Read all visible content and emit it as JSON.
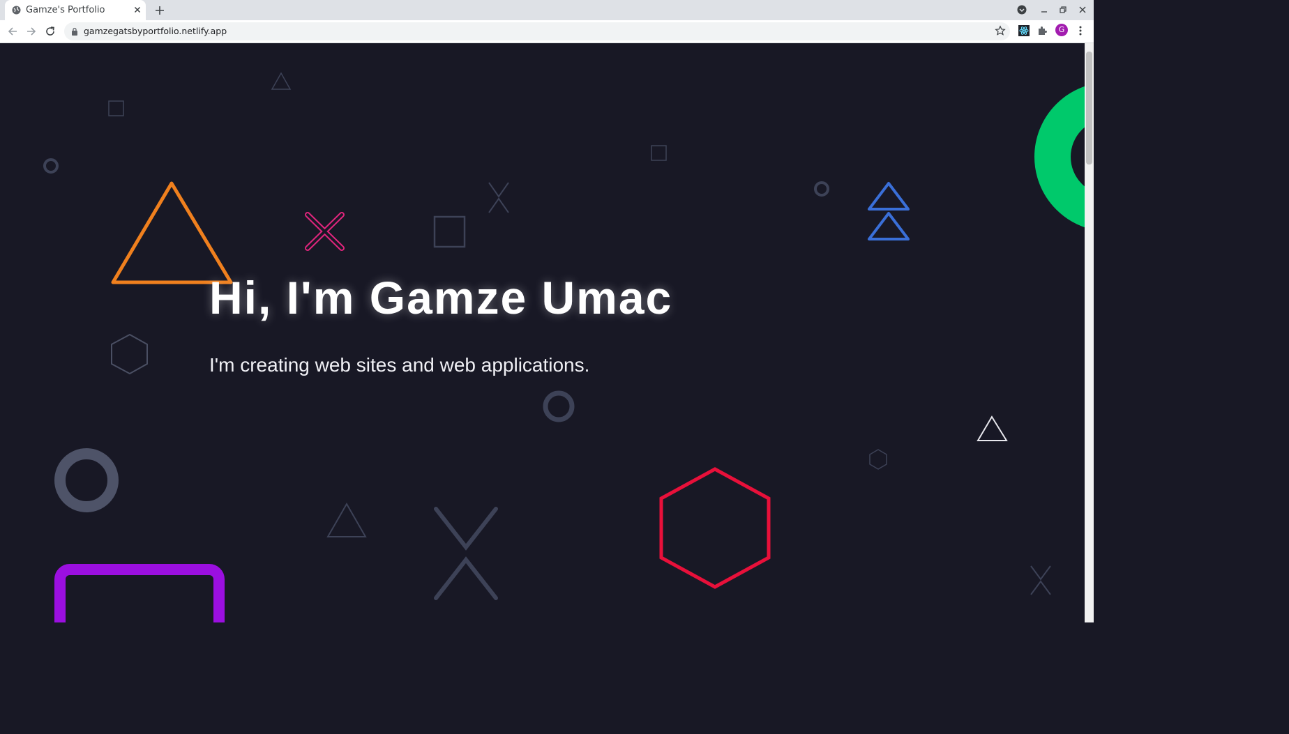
{
  "browser": {
    "tab_title": "Gamze's Portfolio",
    "url": "gamzegatsbyportfolio.netlify.app",
    "avatar_letter": "G"
  },
  "hero": {
    "title": "Hi, I'm Gamze Umac",
    "subtitle": "I'm creating web sites and web applications."
  },
  "colors": {
    "page_background": "#181825",
    "accent_orange": "#f0801e",
    "accent_pink": "#e0257d",
    "accent_blue": "#3a6fd8",
    "accent_green": "#00c96b",
    "accent_red": "#e8103a",
    "accent_purple": "#9b0fe0",
    "muted_shape": "#3d4257"
  }
}
